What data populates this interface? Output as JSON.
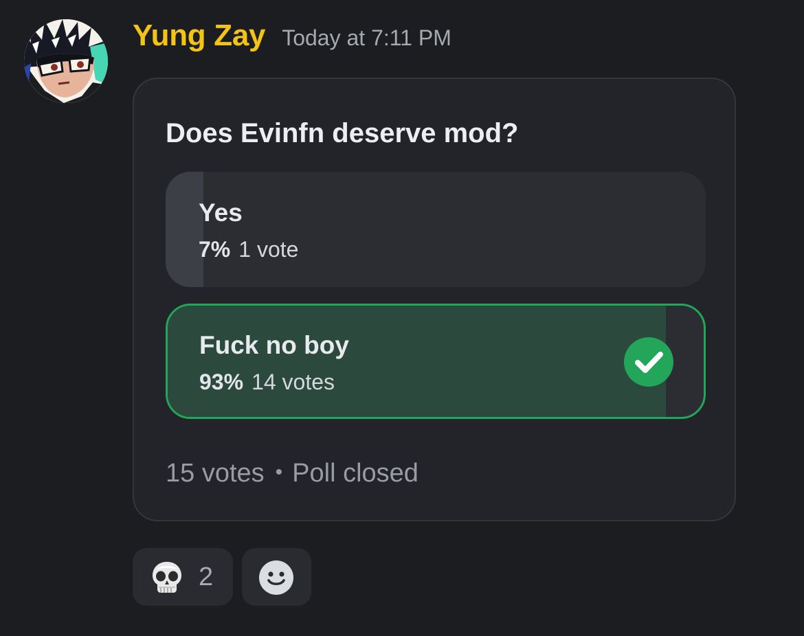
{
  "message": {
    "author": "Yung Zay",
    "timestamp": "Today at 7:11 PM",
    "author_color": "#f3c316",
    "avatar_icon": "anime-avatar"
  },
  "poll": {
    "question": "Does Evinfn deserve mod?",
    "answers": [
      {
        "label": "Yes",
        "percent": "7%",
        "votes": "1 vote",
        "fraction": 0.07,
        "winner": false
      },
      {
        "label": "Fuck no boy",
        "percent": "93%",
        "votes": "14 votes",
        "fraction": 0.93,
        "winner": true,
        "icon": "check-circle-icon"
      }
    ],
    "total_votes": "15 votes",
    "status": "Poll closed",
    "winner_color": "#23a55a"
  },
  "reactions": [
    {
      "emoji": "skull",
      "count": "2"
    },
    {
      "emoji": "add-reaction",
      "icon": "smile-icon"
    }
  ]
}
